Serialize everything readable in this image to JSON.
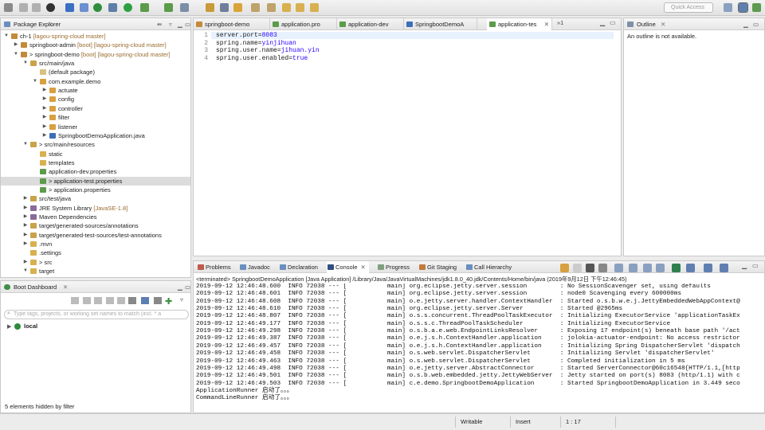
{
  "toolbar": {
    "quick_access": "Quick Access"
  },
  "package_explorer": {
    "title": "Package Explorer",
    "rows": [
      {
        "label": "ch-1",
        "deco": " [lagou-spring-cloud master]"
      },
      {
        "label": "springboot-admin",
        "deco": " [boot] [lagou-spring-cloud master]"
      },
      {
        "label": "> springboot-demo",
        "deco": " [boot] [lagou-spring-cloud master]"
      },
      {
        "label": "src/main/java",
        "deco": ""
      },
      {
        "label": "(default package)",
        "deco": ""
      },
      {
        "label": "com.example.demo",
        "deco": ""
      },
      {
        "label": "actuate",
        "deco": ""
      },
      {
        "label": "config",
        "deco": ""
      },
      {
        "label": "controller",
        "deco": ""
      },
      {
        "label": "filter",
        "deco": ""
      },
      {
        "label": "listener",
        "deco": ""
      },
      {
        "label": "SpringbootDemoApplication.java",
        "deco": ""
      },
      {
        "label": "> src/main/resources",
        "deco": ""
      },
      {
        "label": "static",
        "deco": ""
      },
      {
        "label": "templates",
        "deco": ""
      },
      {
        "label": "application-dev.properties",
        "deco": ""
      },
      {
        "label": "> application-test.properties",
        "deco": ""
      },
      {
        "label": "> application.properties",
        "deco": ""
      },
      {
        "label": "src/test/java",
        "deco": ""
      },
      {
        "label": "JRE System Library",
        "deco": " [JavaSE-1.8]"
      },
      {
        "label": "Maven Dependencies",
        "deco": ""
      },
      {
        "label": "target/generated-sources/annotations",
        "deco": ""
      },
      {
        "label": "target/generated-test-sources/test-annotations",
        "deco": ""
      },
      {
        "label": ".mvn",
        "deco": ""
      },
      {
        "label": ".settings",
        "deco": ""
      },
      {
        "label": "> src",
        "deco": ""
      },
      {
        "label": "target",
        "deco": ""
      }
    ]
  },
  "boot_dashboard": {
    "title": "Boot Dashboard",
    "filter_placeholder": "Type tags, projects, or working set names to match (incl. * a",
    "local": "local",
    "hidden_note": "5 elements hidden by filter"
  },
  "editor": {
    "tabs": [
      "springboot-demo",
      "application.pro",
      "application-dev",
      "SpringbootDemoA",
      "application-tes"
    ],
    "overflow": "»1",
    "lines": [
      {
        "num": "1",
        "text": "server.port=8083"
      },
      {
        "num": "2",
        "text": "spring.name=yinjihuan"
      },
      {
        "num": "3",
        "text": "spring.user.name=jihuan.yin"
      },
      {
        "num": "4",
        "text": "spring.user.enabled=true"
      }
    ]
  },
  "outline": {
    "title": "Outline",
    "message": "An outline is not available."
  },
  "console": {
    "tabs": [
      "Problems",
      "Javadoc",
      "Declaration",
      "Console",
      "Progress",
      "Git Staging",
      "Call Hierarchy"
    ],
    "header": "<terminated> SpringbootDemoApplication [Java Application] /Library/Java/JavaVirtualMachines/jdk1.8.0_40.jdk/Contents/Home/bin/java (2019年9月12日 下午12:46:45)",
    "lines": [
      "2019-09-12 12:46:48.600  INFO 72038 --- [           main] org.eclipse.jetty.server.session         : No SessionScavenger set, using defaults",
      "2019-09-12 12:46:48.601  INFO 72038 --- [           main] org.eclipse.jetty.server.session         : node0 Scavenging every 600000ms",
      "2019-09-12 12:46:48.608  INFO 72038 --- [           main] o.e.jetty.server.handler.ContextHandler  : Started o.s.b.w.e.j.JettyEmbeddedWebAppContext@",
      "2019-09-12 12:46:48.610  INFO 72038 --- [           main] org.eclipse.jetty.server.Server          : Started @2965ms",
      "2019-09-12 12:46:48.807  INFO 72038 --- [           main] o.s.s.concurrent.ThreadPoolTaskExecutor  : Initializing ExecutorService 'applicationTaskEx",
      "2019-09-12 12:46:49.177  INFO 72038 --- [           main] o.s.s.c.ThreadPoolTaskScheduler          : Initializing ExecutorService",
      "2019-09-12 12:46:49.298  INFO 72038 --- [           main] o.s.b.a.e.web.EndpointLinksResolver      : Exposing 17 endpoint(s) beneath base path '/act",
      "2019-09-12 12:46:49.387  INFO 72038 --- [           main] o.e.j.s.h.ContextHandler.application     : jolokia-actuator-endpoint: No access restrictor",
      "2019-09-12 12:46:49.457  INFO 72038 --- [           main] o.e.j.s.h.ContextHandler.application     : Initializing Spring DispatcherServlet 'dispatch",
      "2019-09-12 12:46:49.458  INFO 72038 --- [           main] o.s.web.servlet.DispatcherServlet        : Initializing Servlet 'dispatcherServlet'",
      "2019-09-12 12:46:49.463  INFO 72038 --- [           main] o.s.web.servlet.DispatcherServlet        : Completed initialization in 5 ms",
      "2019-09-12 12:46:49.498  INFO 72038 --- [           main] o.e.jetty.server.AbstractConnector       : Started ServerConnector@60c16548{HTTP/1.1,[http",
      "2019-09-12 12:46:49.501  INFO 72038 --- [           main] o.s.b.web.embedded.jetty.JettyWebServer  : Jetty started on port(s) 8083 (http/1.1) with c",
      "2019-09-12 12:46:49.503  INFO 72038 --- [           main] c.e.demo.SpringbootDemoApplication       : Started SpringbootDemoApplication in 3.449 seco",
      "ApplicationRunner 启动了。。。",
      "CommandLineRunner 启动了。。。"
    ]
  },
  "status": {
    "writable": "Writable",
    "insert": "Insert",
    "position": "1 : 17"
  }
}
